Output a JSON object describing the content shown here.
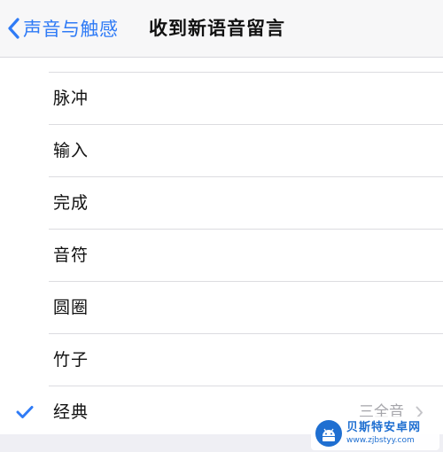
{
  "nav": {
    "back_label": "声音与触感",
    "title": "收到新语音留言"
  },
  "list": {
    "items": [
      {
        "label": "脉冲",
        "selected": false
      },
      {
        "label": "输入",
        "selected": false
      },
      {
        "label": "完成",
        "selected": false
      },
      {
        "label": "音符",
        "selected": false
      },
      {
        "label": "圆圈",
        "selected": false
      },
      {
        "label": "竹子",
        "selected": false
      },
      {
        "label": "经典",
        "selected": true,
        "detail": "三全音"
      }
    ]
  },
  "watermark": {
    "title": "贝斯特安卓网",
    "url": "www.zjbstyy.com"
  },
  "colors": {
    "accent": "#2f7bf6",
    "separator": "#dcdce0",
    "detail_text": "#a5a5aa"
  }
}
